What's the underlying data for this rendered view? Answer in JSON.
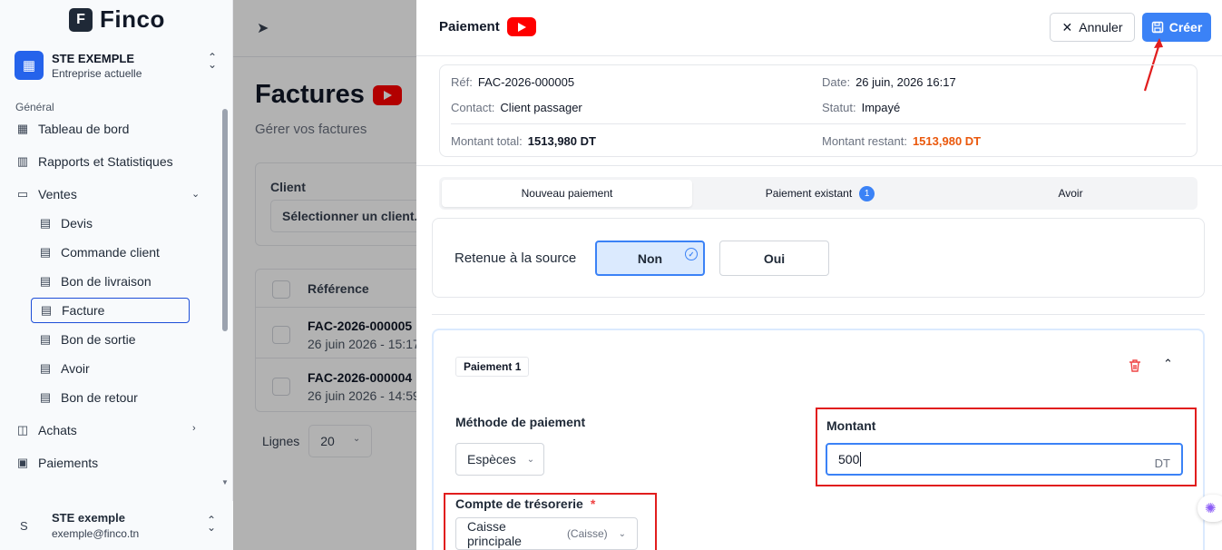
{
  "sidebar": {
    "logo_letter": "F",
    "logo_text": "Finco",
    "company_name": "STE EXEMPLE",
    "company_sub": "Entreprise actuelle",
    "section": "Général",
    "items": [
      {
        "label": "Tableau de bord",
        "icon": "dashboard-icon"
      },
      {
        "label": "Rapports et Statistiques",
        "icon": "chart-icon"
      },
      {
        "label": "Ventes",
        "icon": "wallet-icon"
      },
      {
        "label": "Devis",
        "icon": "document-icon"
      },
      {
        "label": "Commande client",
        "icon": "document-icon"
      },
      {
        "label": "Bon de livraison",
        "icon": "document-icon"
      },
      {
        "label": "Facture",
        "icon": "document-icon"
      },
      {
        "label": "Bon de sortie",
        "icon": "document-icon"
      },
      {
        "label": "Avoir",
        "icon": "document-icon"
      },
      {
        "label": "Bon de retour",
        "icon": "document-icon"
      },
      {
        "label": "Achats",
        "icon": "bag-icon"
      },
      {
        "label": "Paiements",
        "icon": "payment-icon"
      }
    ],
    "user_initial": "S",
    "user_name": "STE exemple",
    "user_email": "exemple@finco.tn"
  },
  "page": {
    "title": "Factures",
    "subtitle": "Gérer vos factures",
    "filter_label": "Client",
    "filter_placeholder": "Sélectionner un client...",
    "table_header": "Référence",
    "rows": [
      {
        "ref": "FAC-2026-000005",
        "date": "26 juin 2026 - 15:17"
      },
      {
        "ref": "FAC-2026-000004",
        "date": "26 juin 2026 - 14:59"
      }
    ],
    "lines_label": "Lignes",
    "lines_value": "20"
  },
  "panel": {
    "title": "Paiement",
    "cancel_label": "Annuler",
    "create_label": "Créer",
    "info": {
      "ref_key": "Réf:",
      "ref_value": "FAC-2026-000005",
      "date_key": "Date:",
      "date_value": "26 juin, 2026 16:17",
      "contact_key": "Contact:",
      "contact_value": "Client passager",
      "status_key": "Statut:",
      "status_value": "Impayé",
      "total_key": "Montant total:",
      "total_value": "1513,980 DT",
      "remaining_key": "Montant restant:",
      "remaining_value": "1513,980 DT"
    },
    "tabs": [
      {
        "label": "Nouveau paiement"
      },
      {
        "label": "Paiement existant",
        "badge": "1"
      },
      {
        "label": "Avoir"
      }
    ],
    "retenue_label": "Retenue à la source",
    "retenue_no": "Non",
    "retenue_yes": "Oui",
    "payment": {
      "tag": "Paiement 1",
      "method_label": "Méthode de paiement",
      "method_value": "Espèces",
      "amount_label": "Montant",
      "amount_value": "500",
      "amount_unit": "DT",
      "account_label": "Compte de trésorerie",
      "account_required": "*",
      "account_value": "Caisse principale",
      "account_type": "(Caisse)"
    }
  },
  "colors": {
    "primary": "#3b82f6",
    "highlight": "#e11d1d",
    "remaining": "#ea580c"
  }
}
